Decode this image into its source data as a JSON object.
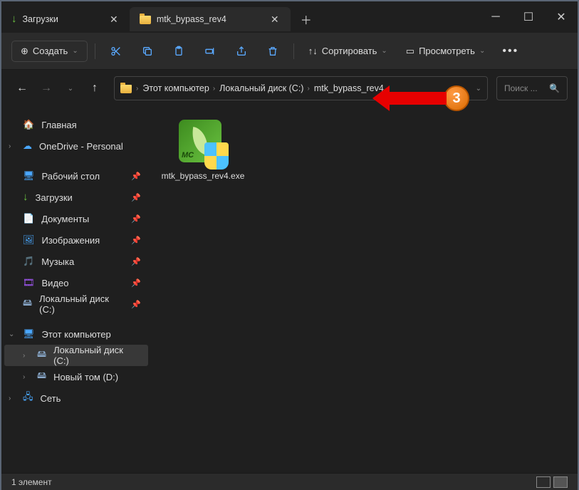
{
  "tabs": [
    {
      "label": "Загрузки",
      "icon": "download"
    },
    {
      "label": "mtk_bypass_rev4",
      "icon": "folder"
    }
  ],
  "toolbar": {
    "new_label": "Создать",
    "sort_label": "Сортировать",
    "view_label": "Просмотреть"
  },
  "breadcrumbs": [
    "Этот компьютер",
    "Локальный диск (C:)",
    "mtk_bypass_rev4"
  ],
  "search": {
    "placeholder": "Поиск ..."
  },
  "sidebar": {
    "quick": [
      {
        "label": "Главная",
        "icon": "home"
      },
      {
        "label": "OneDrive - Personal",
        "icon": "cloud"
      }
    ],
    "pinned": [
      {
        "label": "Рабочий стол",
        "icon": "desktop"
      },
      {
        "label": "Загрузки",
        "icon": "download"
      },
      {
        "label": "Документы",
        "icon": "doc"
      },
      {
        "label": "Изображения",
        "icon": "pic"
      },
      {
        "label": "Музыка",
        "icon": "music"
      },
      {
        "label": "Видео",
        "icon": "video"
      },
      {
        "label": "Локальный диск (C:)",
        "icon": "drive"
      }
    ],
    "pc": {
      "label": "Этот компьютер",
      "children": [
        {
          "label": "Локальный диск (C:)",
          "icon": "drive",
          "selected": true
        },
        {
          "label": "Новый том (D:)",
          "icon": "drive"
        }
      ]
    },
    "network": {
      "label": "Сеть"
    }
  },
  "files": [
    {
      "name": "mtk_bypass_rev4.exe"
    }
  ],
  "status": {
    "count_label": "1 элемент"
  },
  "annotation": {
    "step": "3"
  }
}
